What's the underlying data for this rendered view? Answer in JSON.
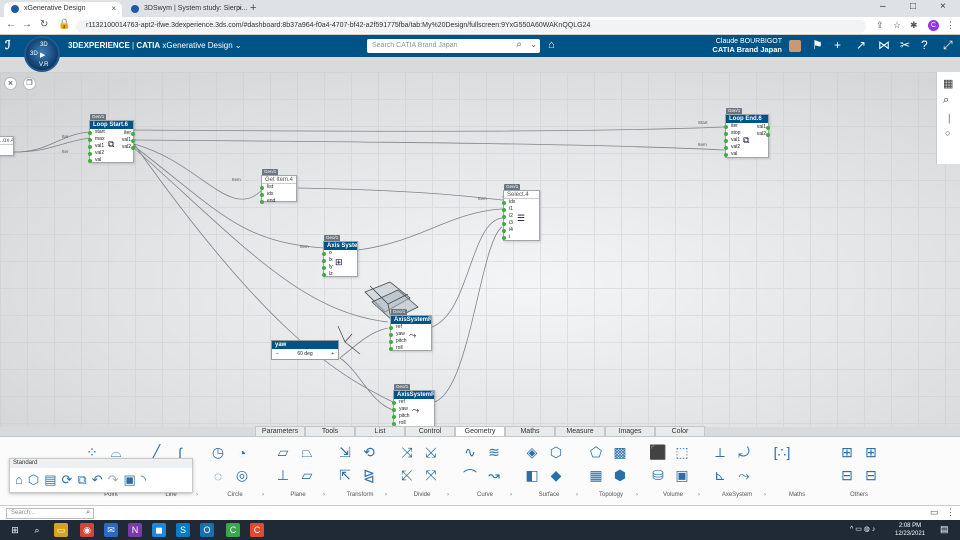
{
  "browser": {
    "tabs": [
      {
        "title": "xGenerative Design",
        "active": true
      },
      {
        "title": "3DSwym | System study: Sierpi...",
        "active": false
      }
    ],
    "url": "r1132100014763-apt2-ifwe.3dexperience.3ds.com/#dashboard:8b37a964-f0a4-4707-bf42-a2f591775fba/tab:My%20Design/fullscreen:9YxG550A60WAKnQQLG24",
    "profile_initial": "C"
  },
  "header": {
    "brand_prefix": "3DEXPERIENCE",
    "brand_sep": " | ",
    "brand_product": "CATIA",
    "app_name": "xGenerative Design",
    "search_placeholder": "Search CATIA Brand Japan",
    "user_name": "Claude BOURBIGOT",
    "company": "CATIA Brand Japan",
    "compass": {
      "n": "3D",
      "w": "3D",
      "s": "V.R"
    }
  },
  "nodes": {
    "loop_start": {
      "badge": "Gen/1",
      "title": "Loop Start.6",
      "ports": [
        "start",
        "max",
        "val1",
        "val2",
        "val"
      ],
      "outs": [
        "iter",
        "val1",
        "val2"
      ]
    },
    "loop_end": {
      "badge": "Gen/1",
      "title": "Loop End.6",
      "ports": [
        "iter",
        "stop",
        "val1",
        "val2",
        "val"
      ],
      "outs": [
        "val1",
        "val2"
      ]
    },
    "get_item": {
      "badge": "Gen/1",
      "title": "Get Item.4",
      "ports": [
        "list",
        "idx",
        "end"
      ]
    },
    "select": {
      "badge": "Gen/1",
      "title": "Select.4",
      "ports": [
        "idx",
        "i1",
        "i2",
        "i3",
        "i4",
        "i"
      ]
    },
    "axis_system": {
      "badge": "Geo/1",
      "title": "Axis System",
      "ports": [
        "o",
        "lx",
        "ly",
        "lz"
      ]
    },
    "axis_rot_1": {
      "badge": "Geo/1",
      "title": "AxisSystemRot",
      "ports": [
        "ref",
        "yaw",
        "pitch",
        "roll"
      ]
    },
    "axis_rot_2": {
      "badge": "Geo/1",
      "title": "AxisSystemRot",
      "ports": [
        "ref",
        "yaw",
        "pitch",
        "roll"
      ]
    },
    "left_stub": {
      "title": "...ox.4"
    },
    "yaw": {
      "badge": "Gen/1",
      "title": "yaw",
      "minus": "−",
      "value": "60 deg",
      "plus": "+"
    }
  },
  "edge_labels": [
    "Iter",
    "Iter",
    "Item",
    "Item",
    "Item",
    "Start",
    "Item"
  ],
  "bottom_tabs": [
    "Parameters",
    "Tools",
    "List",
    "Control",
    "Geometry",
    "Maths",
    "Measure",
    "Images",
    "Color"
  ],
  "active_tab": "Geometry",
  "toolbar_groups": [
    {
      "label": "Point",
      "icons": [
        "point-icon",
        "point-on-curve-icon"
      ]
    },
    {
      "label": "Line",
      "icons": [
        "line-icon",
        "polyline-icon"
      ]
    },
    {
      "label": "Circle",
      "icons": [
        "circle-icon",
        "circle-center-icon",
        "arc-icon",
        "circle-3pt-icon"
      ]
    },
    {
      "label": "Plane",
      "icons": [
        "plane-icon",
        "plane-offset-icon",
        "plane-normal-icon",
        "plane-angle-icon"
      ]
    },
    {
      "label": "Transform",
      "icons": [
        "translate-icon",
        "rotate-icon",
        "scale-icon",
        "mirror-icon"
      ]
    },
    {
      "label": "Divide",
      "icons": [
        "split-icon",
        "trim-icon",
        "divide-icon",
        "project-icon"
      ]
    },
    {
      "label": "Curve",
      "icons": [
        "spline-icon",
        "curve-offset-icon",
        "curve-blend-icon",
        "curve-connect-icon"
      ]
    },
    {
      "label": "Surface",
      "icons": [
        "surface-icon",
        "surface-extrude-icon",
        "surface-sweep-icon",
        "surface-fill-icon"
      ]
    },
    {
      "label": "Topology",
      "icons": [
        "topology-icon",
        "topology-grid-icon",
        "topology-mesh-icon",
        "topology-face-icon"
      ]
    },
    {
      "label": "Volume",
      "icons": [
        "volume-icon",
        "volume-box-icon",
        "volume-cylinder-icon",
        "volume-pad-icon"
      ]
    },
    {
      "label": "AxeSystem",
      "icons": [
        "axis-icon",
        "axis-rotate-icon",
        "axis-pos-icon",
        "axis-dir-icon"
      ]
    },
    {
      "label": "Maths",
      "icons": [
        "matrix-icon"
      ]
    },
    {
      "label": "Others",
      "icons": [
        "others-icon-1",
        "others-icon-2",
        "others-icon-3",
        "others-icon-4"
      ]
    }
  ],
  "standard_panel": {
    "title": "Standard"
  },
  "status": {
    "search_placeholder": "Search..."
  },
  "taskbar": {
    "time": "2:08 PM",
    "date": "12/23/2021"
  }
}
